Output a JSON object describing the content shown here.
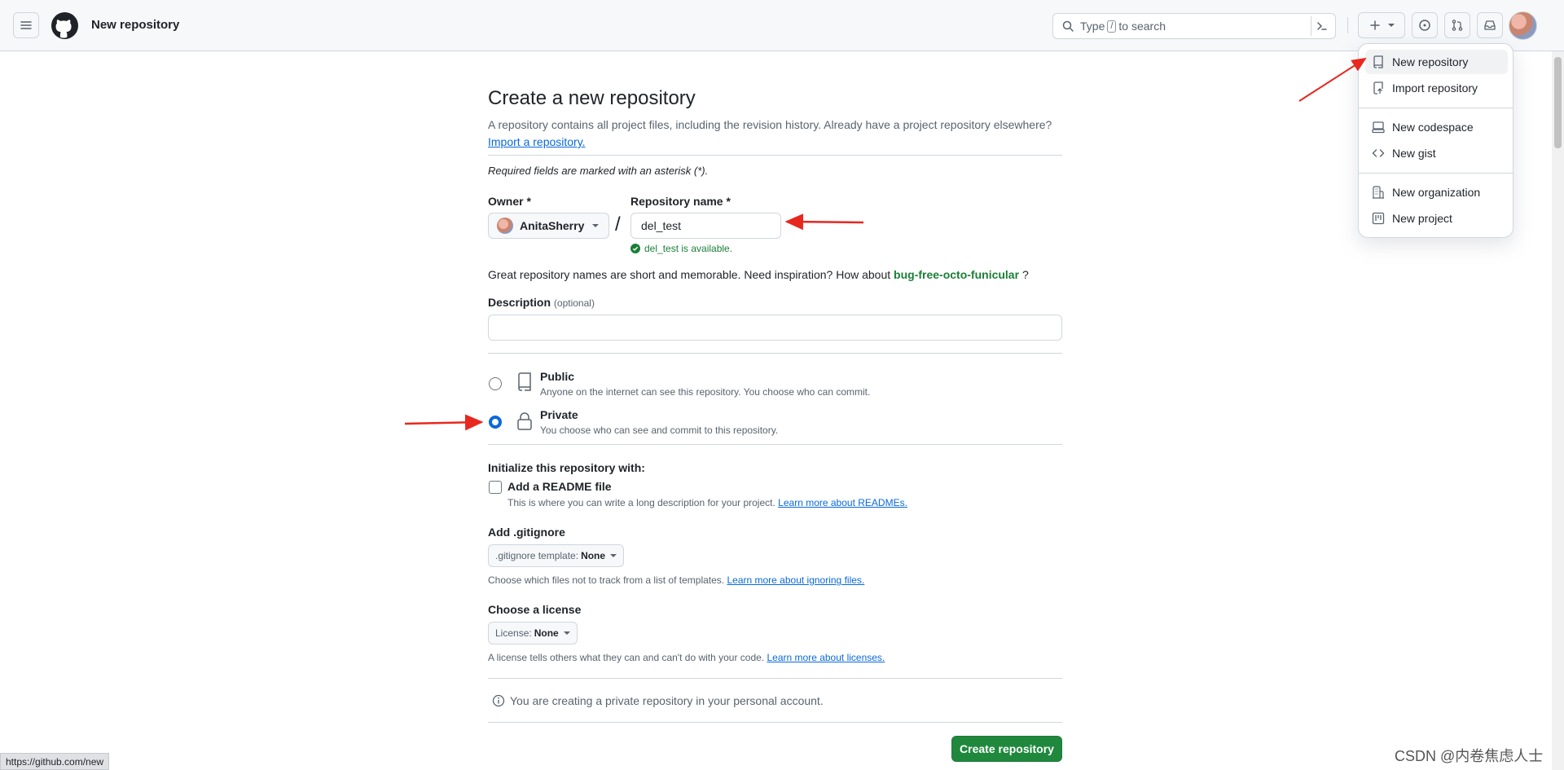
{
  "header": {
    "breadcrumb": "New repository",
    "search": {
      "prefix": "Type",
      "key": "/",
      "suffix": "to search"
    }
  },
  "page": {
    "title": "Create a new repository",
    "subtitle": "A repository contains all project files, including the revision history. Already have a project repository elsewhere?",
    "import_link": "Import a repository.",
    "required_note": "Required fields are marked with an asterisk (*).",
    "owner_label": "Owner *",
    "owner_value": "AnitaSherry",
    "slash": "/",
    "repo_label": "Repository name *",
    "repo_value": "del_test",
    "availability": "del_test is available.",
    "inspiration_text": "Great repository names are short and memorable. Need inspiration? How about",
    "inspiration_suggestion": "bug-free-octo-funicular",
    "inspiration_end": "?",
    "description_label": "Description",
    "description_optional": "(optional)",
    "description_value": "",
    "visibility": {
      "selected": "Private",
      "public_title": "Public",
      "public_desc": "Anyone on the internet can see this repository. You choose who can commit.",
      "private_title": "Private",
      "private_desc": "You choose who can see and commit to this repository."
    },
    "init_label": "Initialize this repository with:",
    "readme_label": "Add a README file",
    "readme_checked": false,
    "readme_desc": "This is where you can write a long description for your project.",
    "readme_link": "Learn more about READMEs.",
    "gitignore_label": "Add .gitignore",
    "gitignore_select_prefix": ".gitignore template:",
    "gitignore_select_value": "None",
    "gitignore_desc": "Choose which files not to track from a list of templates.",
    "gitignore_link": "Learn more about ignoring files.",
    "license_label": "Choose a license",
    "license_select_prefix": "License:",
    "license_select_value": "None",
    "license_desc": "A license tells others what they can and can't do with your code.",
    "license_link": "Learn more about licenses.",
    "info_text": "You are creating a private repository in your personal account.",
    "create_button": "Create repository"
  },
  "dropdown": {
    "items": [
      {
        "label": "New repository",
        "icon": "repo-icon"
      },
      {
        "label": "Import repository",
        "icon": "repo-push-icon"
      },
      {
        "label": "New codespace",
        "icon": "codespaces-icon"
      },
      {
        "label": "New gist",
        "icon": "code-icon"
      },
      {
        "label": "New organization",
        "icon": "organization-icon"
      },
      {
        "label": "New project",
        "icon": "project-icon"
      }
    ]
  },
  "status_bar": {
    "url": "https://github.com/new"
  },
  "watermark": "CSDN @内卷焦虑人士",
  "colors": {
    "accent": "#0969da",
    "success": "#1f883d",
    "annotation_arrow": "#e8271f"
  }
}
